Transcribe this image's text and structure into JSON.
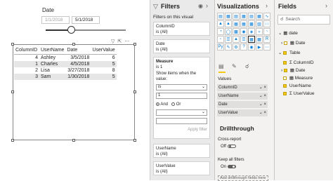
{
  "slicer": {
    "title": "Date",
    "start_date": "1/1/2018",
    "end_date": "5/1/2018"
  },
  "table": {
    "columns": [
      "ColumnID",
      "UserName",
      "Date",
      "UserValue"
    ],
    "rows": [
      [
        "4",
        "Ashley",
        "3/5/2018",
        "6"
      ],
      [
        "1",
        "Charles",
        "4/5/2018",
        "5"
      ],
      [
        "2",
        "Lisa",
        "3/27/2018",
        "8"
      ],
      [
        "3",
        "Sam",
        "1/30/2018",
        "5"
      ]
    ]
  },
  "filters": {
    "title": "Filters",
    "section_label": "Filters on this visual",
    "cards": [
      {
        "name": "ColumnID",
        "value": "is (All)"
      },
      {
        "name": "Date",
        "value": "is (All)"
      }
    ],
    "measure": {
      "name": "Measure",
      "value": "is 1",
      "show_items_label": "Show items when the value:",
      "operator": "is",
      "operand": "1",
      "and_label": "And",
      "or_label": "Or",
      "apply_label": "Apply filter"
    },
    "cards_bottom": [
      {
        "name": "UserName",
        "value": "is (All)"
      },
      {
        "name": "UserValue",
        "value": "is (All)"
      }
    ]
  },
  "visualizations": {
    "title": "Visualizations",
    "values_label": "Values",
    "wells": [
      "ColumnID",
      "UserName",
      "Date",
      "UserValue"
    ],
    "drillthrough_title": "Drillthrough",
    "cross_report_label": "Cross-report",
    "cross_report_state": "Off",
    "keep_filters_label": "Keep all filters",
    "keep_filters_state": "On",
    "add_fields_placeholder": "Add drillthrough fields here"
  },
  "fields": {
    "title": "Fields",
    "search_placeholder": "Search",
    "items": [
      {
        "label": "date",
        "level": 0,
        "kind": "table"
      },
      {
        "label": "Date",
        "level": 1,
        "kind": "calendar"
      },
      {
        "label": "Table",
        "level": 0,
        "kind": "table-checked"
      },
      {
        "label": "ColumnID",
        "level": 1,
        "kind": "sigma-checked"
      },
      {
        "label": "Date",
        "level": 1,
        "kind": "calendar-checked"
      },
      {
        "label": "Measure",
        "level": 1,
        "kind": "measure"
      },
      {
        "label": "UserName",
        "level": 1,
        "kind": "checked"
      },
      {
        "label": "UserValue",
        "level": 1,
        "kind": "sigma-checked"
      }
    ]
  },
  "colors": {
    "accent_yellow": "#f2c811",
    "pane_bg": "#f3f2f1",
    "filters_bg": "#eaeaea"
  }
}
